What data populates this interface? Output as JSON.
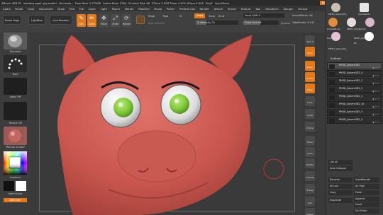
{
  "titlebar": {
    "items": [
      "ZBrush 4R8 P1",
      "starting again pig model - the body -",
      "Free Mem 1.272GB",
      "Active Mem 1784",
      "Scratch Disk 48",
      "ZTime 2.628 Timer 0.001 ATime 0.005",
      "PolyF",
      "QuickSave"
    ],
    "see_through": "See-through 0",
    "menus_btn": "Menus",
    "script_btn": "DefaultZScript"
  },
  "menubar": [
    "Alpha",
    "Brush",
    "Color",
    "Document",
    "Draw",
    "Edit",
    "File",
    "Layer",
    "Light",
    "Macro",
    "Marker",
    "Material",
    "Movie",
    "Picker",
    "Preferences",
    "Render",
    "Stencil",
    "Stroke",
    "Texture",
    "Tool",
    "Transform",
    "Zplugin",
    "Zscript"
  ],
  "toolbar": {
    "home_page": "Home Page",
    "lightbox": "LightBox",
    "live_boolean": "Live Boolean",
    "tools": [
      {
        "label": "Edit",
        "state": "on",
        "icon": "edit-icon",
        "glyph": "✎"
      },
      {
        "label": "Draw",
        "state": "on",
        "icon": "draw-icon",
        "glyph": "✏"
      },
      {
        "label": "Move",
        "state": "off",
        "icon": "move-icon",
        "glyph": "✥"
      },
      {
        "label": "Scale",
        "state": "off",
        "icon": "scale-icon",
        "glyph": "⤢"
      },
      {
        "label": "Rotate",
        "state": "off",
        "icon": "rotate-icon",
        "glyph": "⟳"
      }
    ],
    "rgb_icon_label": "",
    "mrgb": "Mrgb",
    "rgb": "Rgb",
    "m": "M",
    "rgb_intensity": "Rgb Intensity",
    "zadd": "Zadd",
    "zsub": "Zsub",
    "zcut": "Zcut",
    "z_intensity": "Z Intensity 25",
    "z_intensity_value": 0.25,
    "focal_shift": "Focal Shift 0",
    "draw_size": "Draw Size 64",
    "dynamic": "Dynamic",
    "active_points": "ActivePoints: 5K",
    "total_points": "TotalPoints: 8.471"
  },
  "left_tray": {
    "brush_label": "Standard",
    "stroke_label": "Dots",
    "alpha_label": "Alpha Off",
    "texture_label": "Texture Off",
    "material_label": "MatCap Sculpt2",
    "gradient_label": "Gradient",
    "switch_color_label": "SwitchColor",
    "alternate_label": "Alternate"
  },
  "side_icons": [
    {
      "label": "SPix 3",
      "state": "off",
      "icon": "spix-icon"
    },
    {
      "label": "Scroll",
      "state": "on",
      "icon": "scroll-icon"
    },
    {
      "label": "Zoom",
      "state": "on",
      "icon": "zoom-icon"
    },
    {
      "label": "Actual",
      "state": "on",
      "icon": "actual-icon"
    },
    {
      "label": "Persp",
      "state": "on",
      "icon": "persp-icon"
    },
    {
      "label": "Floor",
      "state": "off",
      "icon": "floor-icon"
    },
    {
      "label": "Local",
      "state": "off",
      "icon": "local-icon"
    },
    {
      "label": "Frame",
      "state": "off",
      "icon": "frame-icon"
    },
    {
      "label": "Move",
      "state": "off",
      "icon": "move-view-icon"
    },
    {
      "label": "Scale",
      "state": "off",
      "icon": "scale-view-icon"
    },
    {
      "label": "Rotate",
      "state": "off",
      "icon": "rotate-view-icon"
    },
    {
      "label": "Line Fill",
      "state": "off",
      "icon": "linefill-icon"
    },
    {
      "label": "Transp",
      "state": "off",
      "icon": "transp-icon"
    },
    {
      "label": "Solo",
      "state": "off",
      "icon": "solo-icon"
    },
    {
      "label": "Xpose",
      "state": "off",
      "icon": "xpose-icon"
    }
  ],
  "right_panel": {
    "tool_thumbs": [
      {
        "label": "PM3D_Sphere3D_",
        "color": "#c9bfb3"
      },
      {
        "label": "Cylinder3D",
        "color": "#e6e6e6"
      },
      {
        "label": "SimpleBrush",
        "color": "#e08c3a"
      },
      {
        "label": "PM3D_PolySphere",
        "color": "#e9d9d9"
      },
      {
        "label": "PolySphere",
        "color": "#d8b7c7"
      },
      {
        "label": "PM3D_PolySphere",
        "color": "#e6c0d0"
      }
    ],
    "count": "27",
    "extra_thumb_label": "PM3D_Sphere3D_",
    "subtool_title": "Subtool",
    "subtools": [
      {
        "name": "PM3D_Sphere3D1",
        "selected": true
      },
      {
        "name": "PM3D_Sphere3D2_4",
        "selected": false
      },
      {
        "name": "PM3D_Sphere3D2_3",
        "selected": false
      },
      {
        "name": "PM3D_Sphere3D2_2",
        "selected": false
      },
      {
        "name": "PM3D_Sphere3D2_1",
        "selected": false
      },
      {
        "name": "PM3D_Sphere3D2_10",
        "selected": false
      },
      {
        "name": "PM3D_Sphere3D2_5",
        "selected": false
      },
      {
        "name": "PM3D_Sphere3D2_3",
        "selected": false
      }
    ],
    "list_all": "List All",
    "auto_collapse": "Auto Collapse",
    "rename": "Rename",
    "auto_reorder": "AutoReorder",
    "all_low": "All Low",
    "all_high": "All High",
    "copy": "Copy",
    "paste": "Paste",
    "duplicate": "Duplicate",
    "append": "Append",
    "insert": "Insert",
    "delete": "Del Other"
  },
  "colors": {
    "accent": "#e07a1c",
    "pig_skin": "#c9574f",
    "eye_green": "#7fc83a"
  }
}
